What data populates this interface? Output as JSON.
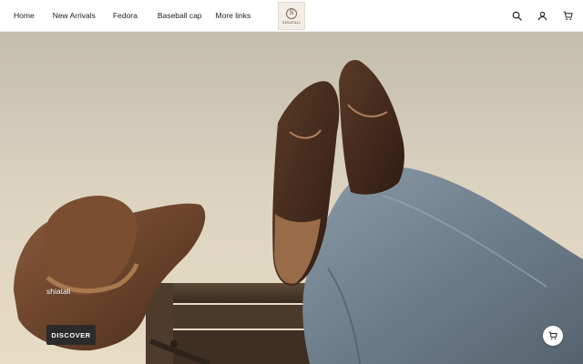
{
  "nav": {
    "items": [
      {
        "label": "Home"
      },
      {
        "label": "New Arrivals"
      },
      {
        "label": "Fedora"
      },
      {
        "label": "Baseball cap"
      },
      {
        "label": "More links"
      }
    ]
  },
  "logo": {
    "mark": "S",
    "text": "SHIATALI"
  },
  "header_icons": [
    "search-icon",
    "account-icon",
    "cart-icon"
  ],
  "hero": {
    "caption": "shiatali",
    "button_label": "DISCOVER"
  },
  "floating_cart": {
    "icon": "cart-icon"
  },
  "colors": {
    "button_bg": "#2b2b2b",
    "header_bg": "#ffffff"
  }
}
